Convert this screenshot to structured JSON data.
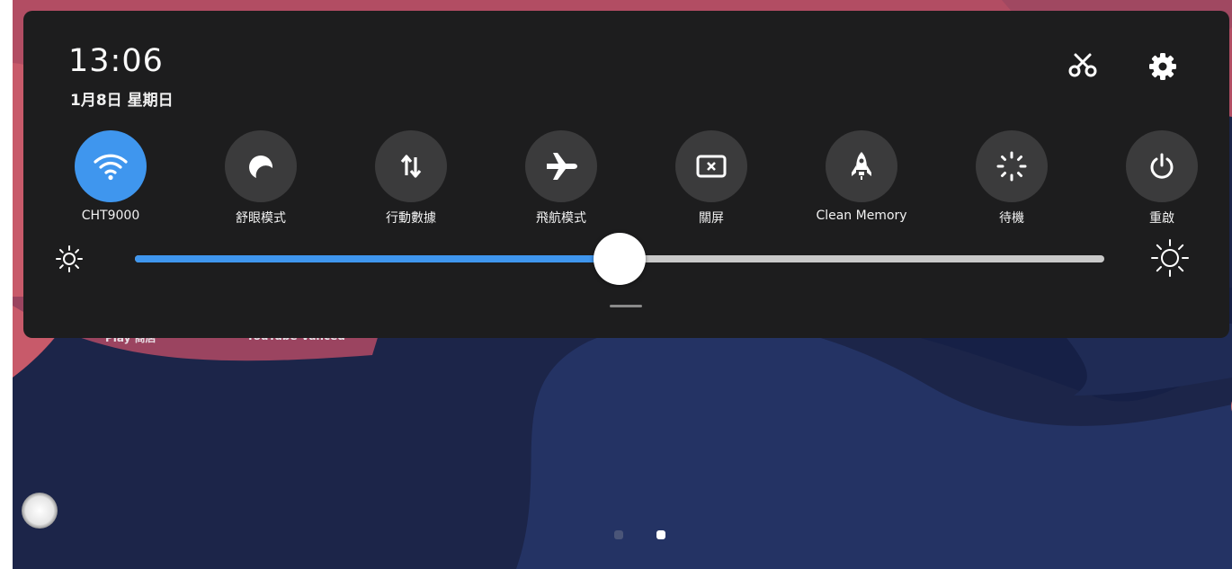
{
  "status": {
    "time": "13:06",
    "date": "1月8日 星期日"
  },
  "header_icons": [
    {
      "name": "scissors-icon"
    },
    {
      "name": "gear-icon"
    }
  ],
  "tiles": [
    {
      "label": "CHT9000",
      "icon": "wifi-icon",
      "active": true
    },
    {
      "label": "舒眼模式",
      "icon": "moon-icon",
      "active": false
    },
    {
      "label": "行動數據",
      "icon": "mobile-data-icon",
      "active": false
    },
    {
      "label": "飛航模式",
      "icon": "airplane-icon",
      "active": false
    },
    {
      "label": "關屏",
      "icon": "screen-off-icon",
      "active": false
    },
    {
      "label": "Clean Memory",
      "icon": "rocket-icon",
      "active": false
    },
    {
      "label": "待機",
      "icon": "standby-icon",
      "active": false
    },
    {
      "label": "重啟",
      "icon": "power-icon",
      "active": false
    }
  ],
  "brightness": {
    "level": 0.5,
    "low_icon": "sun-small-icon",
    "high_icon": "sun-large-icon"
  },
  "home_screen": {
    "app_labels": [
      "Play 商店",
      "YouTube Vanced"
    ],
    "pages": 2,
    "current_page": 2
  },
  "colors": {
    "panel": "#1d1d1e",
    "accent": "#3f96ee",
    "tile_inactive": "#3b3b3c",
    "wallpaper_dark": "#1c2549",
    "wallpaper_pink": "#a0475e"
  }
}
